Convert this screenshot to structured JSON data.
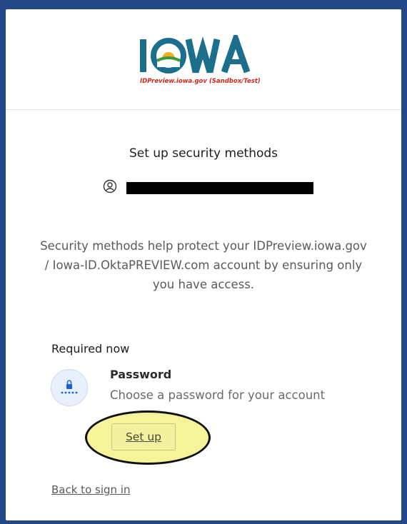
{
  "header": {
    "logo_text": "IOWA",
    "logo_subtitle": "IDPreview.iowa.gov (Sandbox/Test)"
  },
  "main": {
    "title": "Set up security methods",
    "description": "Security methods help protect your IDPreview.iowa.gov / Iowa-ID.OktaPREVIEW.com account by ensuring only you have access.",
    "required_label": "Required now",
    "method": {
      "name": "Password",
      "description": "Choose a password for your account",
      "button_label": "Set up"
    },
    "back_link": "Back to sign in"
  },
  "colors": {
    "background": "#234787",
    "logo_primary": "#1c6f8c",
    "logo_subtitle": "#d4281c",
    "highlight": "#f6f49a"
  },
  "icons": {
    "user": "user-circle-icon",
    "method": "password-lock-icon",
    "logo_sun": "sun-icon"
  }
}
